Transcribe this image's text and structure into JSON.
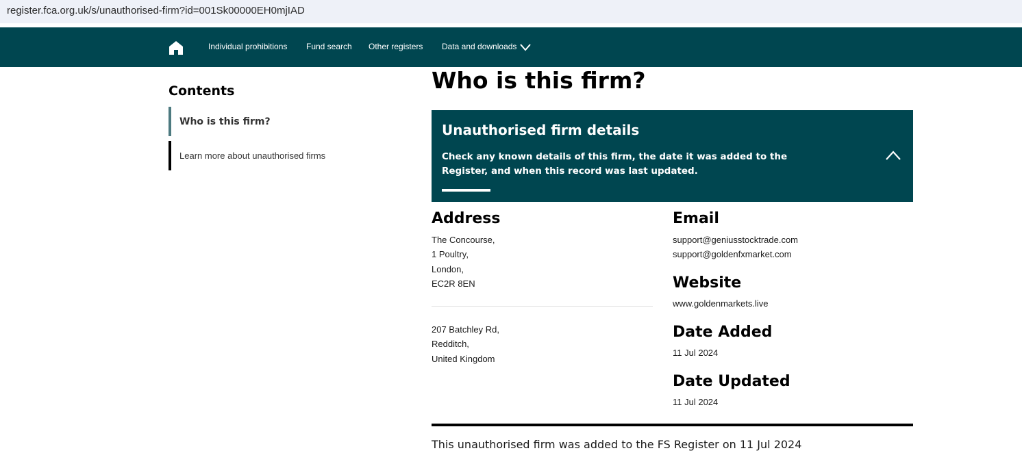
{
  "browser": {
    "url": "register.fca.org.uk/s/unauthorised-firm?id=001Sk00000EH0mjIAD"
  },
  "nav": {
    "items": [
      {
        "label": "Individual prohibitions"
      },
      {
        "label": "Fund search"
      },
      {
        "label": "Other registers"
      },
      {
        "label": "Data and downloads"
      }
    ],
    "home_icon": "home-icon",
    "dropdown_icon": "chevron-down-icon"
  },
  "sidebar": {
    "title": "Contents",
    "items": [
      {
        "label": "Who is this firm?",
        "active": true
      },
      {
        "label": "Learn more about unauthorised firms",
        "active": false
      }
    ]
  },
  "main": {
    "title": "Who is this firm?",
    "banner": {
      "title": "Unauthorised firm details",
      "description": "Check any known details of this firm, the date it was added to the Register, and when this record was last updated.",
      "toggle_icon": "chevron-up-icon"
    },
    "address": {
      "heading": "Address",
      "blocks": [
        [
          "The Concourse,",
          "1 Poultry,",
          "London,",
          "EC2R 8EN"
        ],
        [
          "207 Batchley Rd,",
          "Redditch,",
          "United Kingdom"
        ]
      ]
    },
    "email": {
      "heading": "Email",
      "values": [
        "support@geniusstocktrade.com",
        "support@goldenfxmarket.com"
      ]
    },
    "website": {
      "heading": "Website",
      "value": "www.goldenmarkets.live"
    },
    "date_added": {
      "heading": "Date Added",
      "value": "11 Jul 2024"
    },
    "date_updated": {
      "heading": "Date Updated",
      "value": "11 Jul 2024"
    },
    "footer_note": "This unauthorised firm was added to the FS Register on 11 Jul 2024"
  },
  "colors": {
    "brand": "#004650",
    "toc_active_border": "#4d7a80"
  }
}
